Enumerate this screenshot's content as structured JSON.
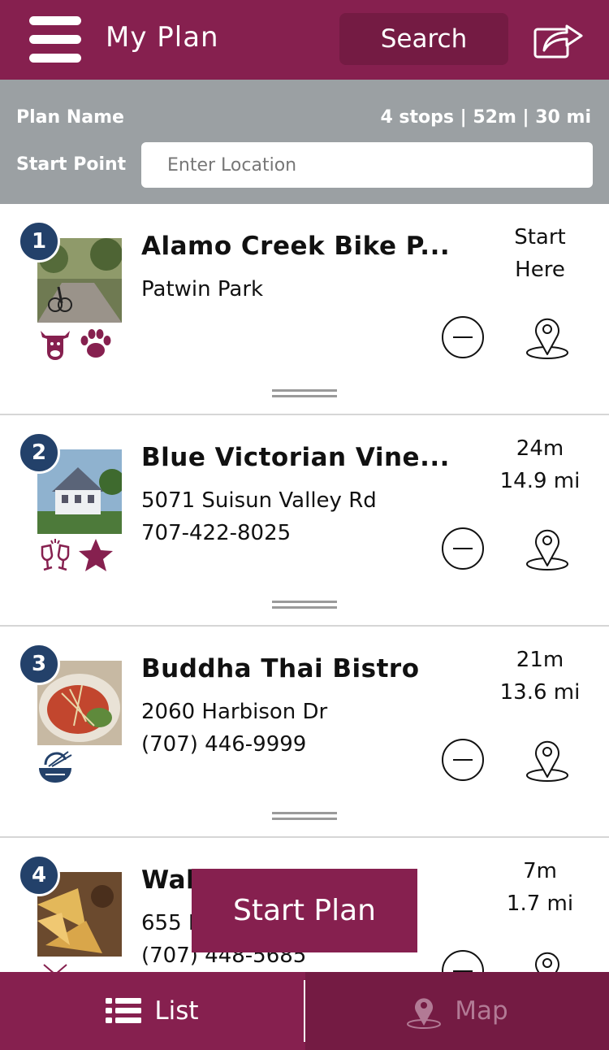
{
  "header": {
    "title": "My Plan",
    "search_label": "Search"
  },
  "plan": {
    "name_label": "Plan Name",
    "stats": "4 stops | 52m | 30 mi",
    "start_point_label": "Start Point",
    "start_point_placeholder": "Enter Location"
  },
  "stops": [
    {
      "number": "1",
      "name": "Alamo Creek Bike P...",
      "line1": "Patwin Park",
      "line2": "",
      "time": "Start",
      "distance": "Here",
      "icons": [
        "cow-icon",
        "paw-icon"
      ]
    },
    {
      "number": "2",
      "name": "Blue Victorian Vine...",
      "line1": "5071 Suisun Valley Rd",
      "line2": "707-422-8025",
      "time": "24m",
      "distance": "14.9 mi",
      "icons": [
        "wine-glasses-icon",
        "star-icon"
      ]
    },
    {
      "number": "3",
      "name": "Buddha Thai Bistro",
      "line1": "2060 Harbison Dr",
      "line2": "(707) 446-9999",
      "time": "21m",
      "distance": "13.6 mi",
      "icons": [
        "noodle-bowl-icon"
      ]
    },
    {
      "number": "4",
      "name": "Wah",
      "line1": "655 E",
      "line2": "(707) 448-5685",
      "time": "7m",
      "distance": "1.7 mi",
      "icons": [
        "chevron-down-icon"
      ]
    }
  ],
  "start_plan_label": "Start Plan",
  "nav": {
    "list_label": "List",
    "map_label": "Map"
  },
  "colors": {
    "brand": "#86204f",
    "brand_dark": "#741b43",
    "badge": "#23416a",
    "bar": "#9ba0a3"
  }
}
